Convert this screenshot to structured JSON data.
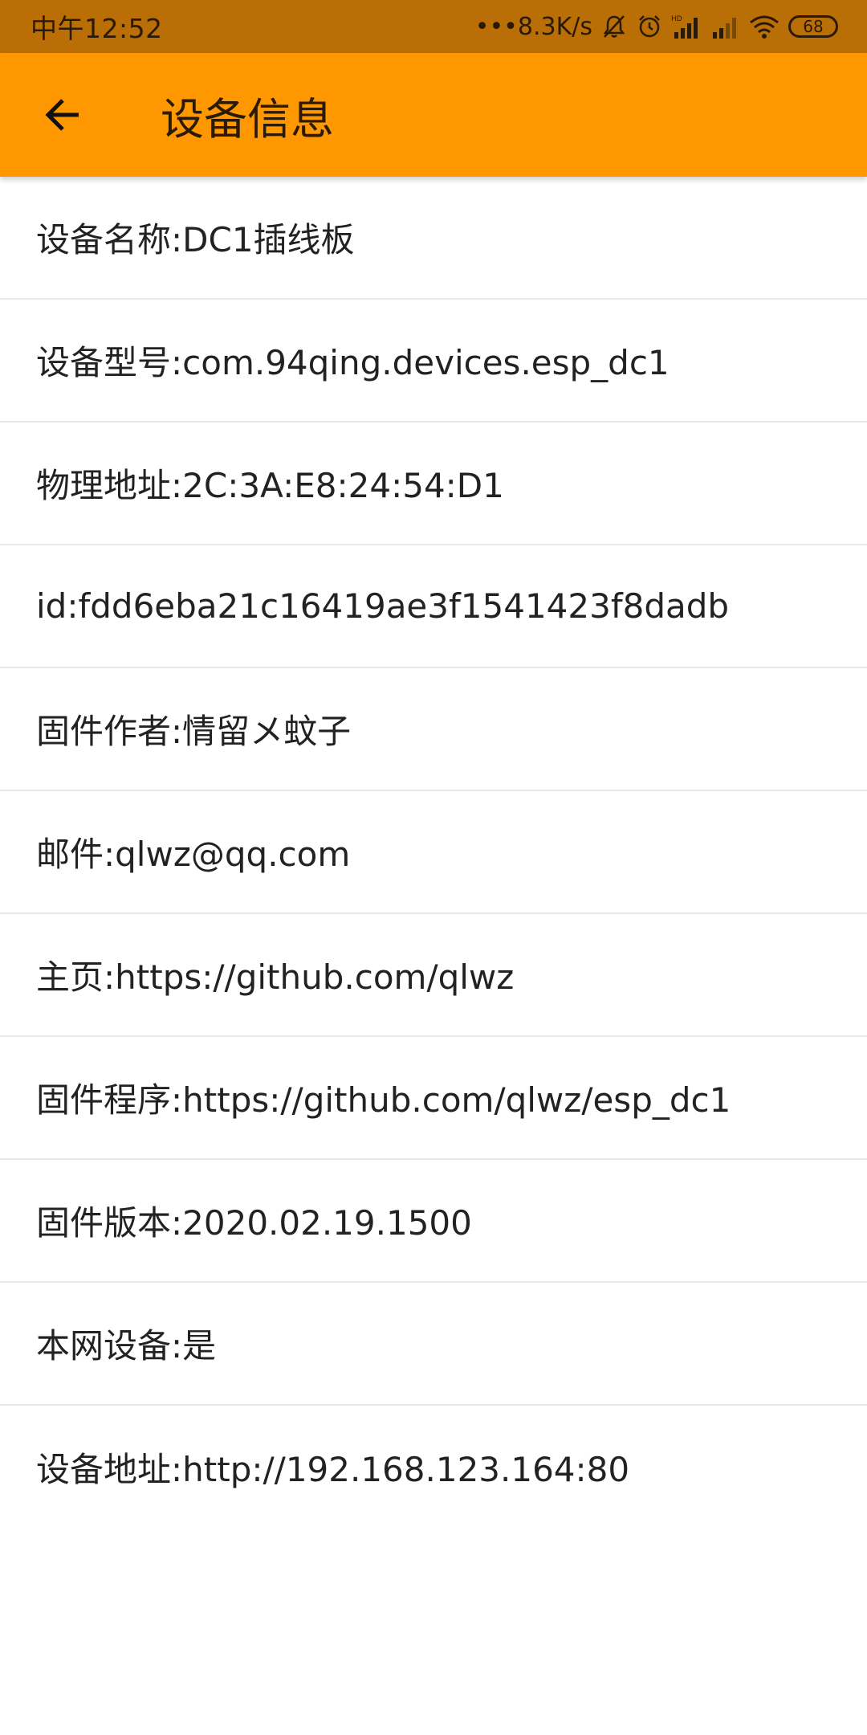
{
  "status_bar": {
    "time": "中午12:52",
    "network_speed": "•••8.3K/s",
    "battery_level": "68",
    "icons": [
      "mute-bell-icon",
      "alarm-icon",
      "hd-signal-icon",
      "signal-icon",
      "wifi-icon",
      "battery-icon"
    ]
  },
  "app_bar": {
    "title": "设备信息",
    "back_icon": "arrow-back-icon",
    "color": "#ff9800"
  },
  "items": [
    {
      "text": "设备名称:DC1插线板"
    },
    {
      "text": "设备型号:com.94qing.devices.esp_dc1"
    },
    {
      "text": "物理地址:2C:3A:E8:24:54:D1"
    },
    {
      "text": "id:fdd6eba21c16419ae3f1541423f8dadb"
    },
    {
      "text": "固件作者:情留メ蚊子"
    },
    {
      "text": "邮件:qlwz@qq.com"
    },
    {
      "text": "主页:https://github.com/qlwz"
    },
    {
      "text": "固件程序:https://github.com/qlwz/esp_dc1"
    },
    {
      "text": "固件版本:2020.02.19.1500"
    },
    {
      "text": "本网设备:是"
    },
    {
      "text": "设备地址:http://192.168.123.164:80"
    }
  ]
}
